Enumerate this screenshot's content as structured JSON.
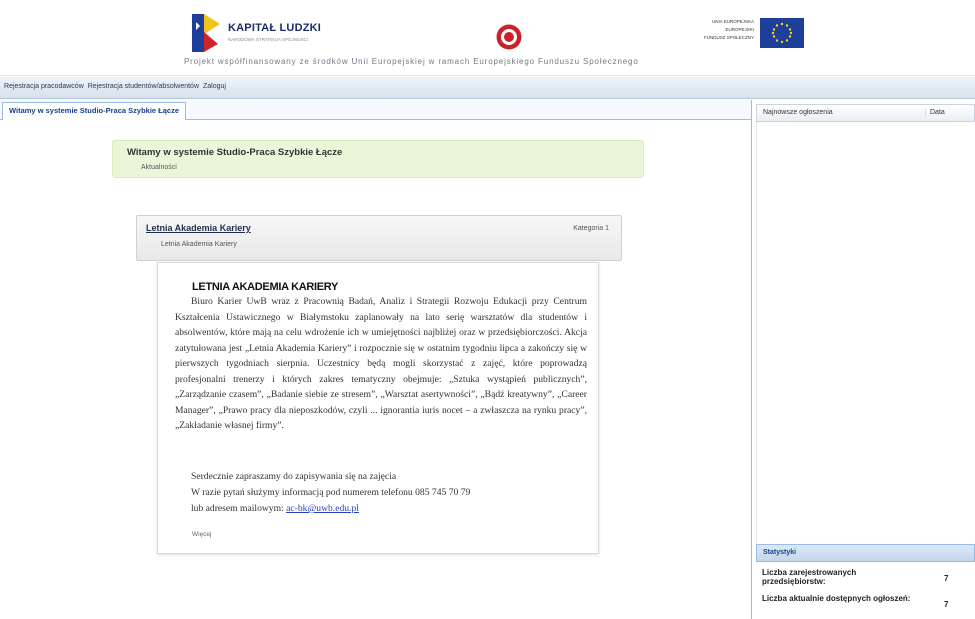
{
  "header": {
    "logo_title": "KAPITAŁ LUDZKI",
    "logo_subtitle": "NARODOWA STRATEGIA SPÓJNOŚCI",
    "eu_text_line1": "UNIA EUROPEJSKA",
    "eu_text_line2": "EUROPEJSKI",
    "eu_text_line3": "FUNDUSZ SPOŁECZNY",
    "caption": "Projekt współfinansowany ze środków Unii Europejskiej w ramach Europejskiego Funduszu Społecznego"
  },
  "topnav": {
    "items": [
      "Rejestracja pracodawców",
      "Rejestracja studentów/absolwentów",
      "Zaloguj"
    ]
  },
  "tab": {
    "label": "Witamy w systemie Studio-Praca Szybkie Łącze"
  },
  "welcome": {
    "title": "Witamy w systemie Studio-Praca Szybkie Łącze",
    "subtitle": "Aktualności"
  },
  "news": {
    "title": "Letnia Akademia Kariery",
    "category": "Kategoria 1",
    "lead": "Letnia Akademia Kariery"
  },
  "article": {
    "heading": "LETNIA AKADEMIA KARIERY",
    "body": "Biuro Karier UwB wraz z Pracownią Badań, Analiz i Strategii Rozwoju Edukacji przy Centrum Kształcenia Ustawicznego w Białymstoku zaplanowały na lato serię warsztatów dla studentów i absolwentów, które mają na celu wdrożenie ich w umiejętności najbliżej oraz w przedsiębiorczości. Akcja zatytułowana jest „Letnia Akademia Kariery” i rozpocznie się w ostatnim tygodniu lipca a zakończy się w pierwszych tygodniach sierpnia. Uczestnicy będą mogli skorzystać z zajęć, które poprowadzą profesjonalni trenerzy i których zakres tematyczny obejmuje: „Sztuka wystąpień publicznych”, „Zarządzanie czasem”, „Badanie siebie ze stresem”, „Warsztat asertywności”, „Bądź kreatywny”, „Career Manager”, „Prawo pracy dla nieposzkodów, czyli ... ignorantia iuris nocet – a zwłaszcza na rynku pracy”, „Zakładanie własnej firmy”.",
    "line_invite": "Serdecznie zapraszamy do zapisywania się na zajęcia",
    "line_phone": "W razie pytań służymy informacją pod numerem telefonu 085 745 70 79",
    "line_email_prefix": "lub adresem mailowym:",
    "email": "ac-bk@uwb.edu.pl",
    "footer": "Więcej"
  },
  "right_panel": {
    "col_newest": "Najnowsze ogłoszenia",
    "col_date": "Data"
  },
  "stats": {
    "title": "Statystyki",
    "rows": [
      {
        "label": "Liczba zarejestrowanych przedsiębiorstw:",
        "value": "7"
      },
      {
        "label": "Liczba aktualnie dostępnych ogłoszeń:",
        "value": "7"
      }
    ]
  },
  "colors": {
    "accent_blue": "#15428b",
    "welcome_green": "#eaf6d8",
    "eu_blue": "#1d3f99",
    "link_blue": "#2a3fb0"
  }
}
